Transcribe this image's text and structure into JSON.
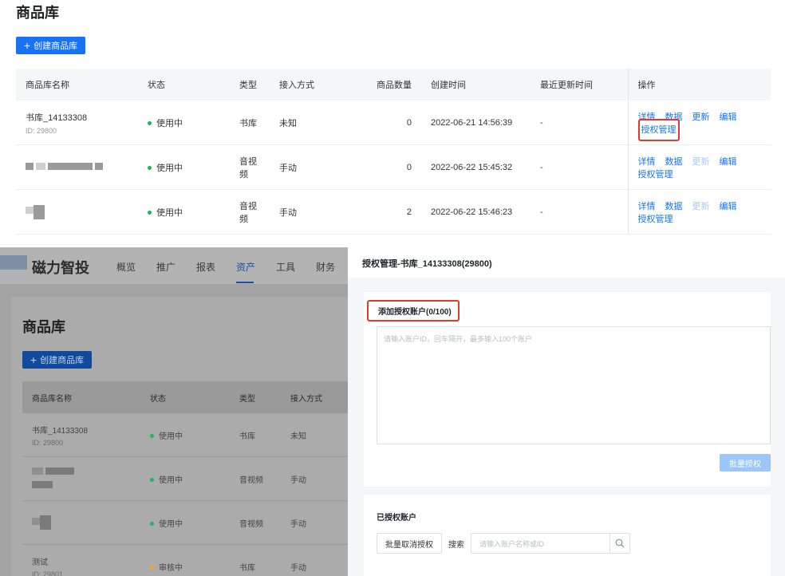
{
  "top": {
    "title": "商品库",
    "create_button": "创建商品库",
    "columns": [
      "商品库名称",
      "状态",
      "类型",
      "接入方式",
      "商品数量",
      "创建时间",
      "最近更新时间",
      "操作"
    ],
    "rows": [
      {
        "name": "书库_14133308",
        "id": "ID: 29800",
        "status": "使用中",
        "type": "书库",
        "access": "未知",
        "count": "0",
        "created": "2022-06-21 14:56:39",
        "updated": "-"
      },
      {
        "name": "",
        "id": "",
        "status": "使用中",
        "type": "音视频",
        "access": "手动",
        "count": "0",
        "created": "2022-06-22 15:45:32",
        "updated": "-"
      },
      {
        "name": "",
        "id": "",
        "status": "使用中",
        "type": "音视频",
        "access": "手动",
        "count": "2",
        "created": "2022-06-22 15:46:23",
        "updated": "-"
      }
    ],
    "ops": [
      "详情",
      "数据",
      "更新",
      "编辑",
      "授权管理"
    ]
  },
  "bottom_left": {
    "logo": "磁力智投",
    "nav": [
      "概览",
      "推广",
      "报表",
      "资产",
      "工具",
      "财务"
    ],
    "active_nav": "资产",
    "title": "商品库",
    "create_button": "创建商品库",
    "columns": [
      "商品库名称",
      "状态",
      "类型",
      "接入方式"
    ],
    "rows": [
      {
        "name": "书库_14133308",
        "id": "ID: 29800",
        "status": "使用中",
        "type": "书库",
        "access": "未知"
      },
      {
        "name": "",
        "id": "",
        "status": "使用中",
        "type": "音视频",
        "access": "手动"
      },
      {
        "name": "",
        "id": "",
        "status": "使用中",
        "type": "音视频",
        "access": "手动"
      },
      {
        "name": "测试",
        "id": "ID: 29801",
        "status": "审核中",
        "type": "书库",
        "access": "手动"
      }
    ]
  },
  "bottom_right": {
    "title": "授权管理-书库_14133308(29800)",
    "add_label": "添加授权账户(0/100)",
    "textarea_placeholder": "请输入账户ID，回车隔开，最多输入100个账户",
    "batch_button": "批量授权",
    "authorized_label": "已授权账户",
    "cancel_button": "批量取消授权",
    "search_label": "搜索",
    "search_placeholder": "请输入账户名称或ID"
  },
  "colors": {
    "primary": "#1673f5",
    "highlight_box": "#e03a2c",
    "status_green": "#21b35f",
    "status_orange": "#f5a623"
  },
  "icons": {
    "plus": "plus-icon",
    "search": "search-icon",
    "logo": "logo-mark-icon"
  }
}
